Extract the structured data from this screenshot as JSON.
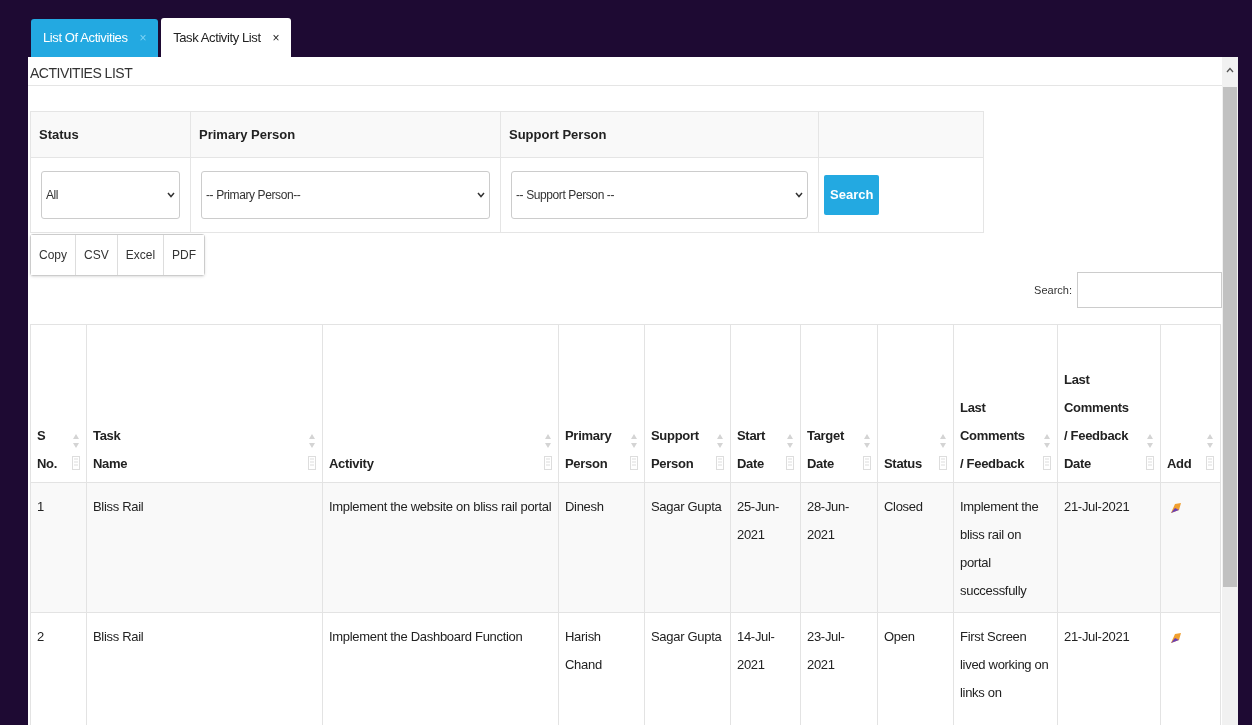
{
  "tabs": [
    {
      "label": "List Of Activities",
      "close": "×",
      "selected": false
    },
    {
      "label": "Task Activity List",
      "close": "×",
      "selected": true
    }
  ],
  "panel_title": "ACTIVITIES LIST",
  "filters": [
    {
      "label": "Status",
      "value": "All"
    },
    {
      "label": "Primary Person",
      "value": "-- Primary Person--"
    },
    {
      "label": "Support Person",
      "value": "-- Support Person --"
    }
  ],
  "search_button": "Search",
  "export_buttons": [
    "Copy",
    "CSV",
    "Excel",
    "PDF"
  ],
  "table_search": {
    "label": "Search:"
  },
  "table": {
    "columns": [
      "S No.",
      "Task Name",
      "Activity",
      "Primary Person",
      "Support Person",
      "Start Date",
      "Target Date",
      "Status",
      "Last Comments / Feedback",
      "Last Comments / Feedback Date",
      "Add"
    ],
    "rows": [
      {
        "cells": [
          "1",
          "Bliss Rail",
          "Implement the website on bliss rail portal",
          "Dinesh",
          "Sagar Gupta",
          "25-Jun-2021",
          "28-Jun-2021",
          "Closed",
          "Implement the bliss rail on portal successfully",
          "21-Jul-2021"
        ]
      },
      {
        "cells": [
          "2",
          "Bliss Rail",
          "Implement the Dashboard Function",
          "Harish Chand",
          "Sagar Gupta",
          "14-Jul-2021",
          "23-Jul-2021",
          "Open",
          "First Screen lived working on links on",
          "21-Jul-2021"
        ]
      }
    ]
  }
}
